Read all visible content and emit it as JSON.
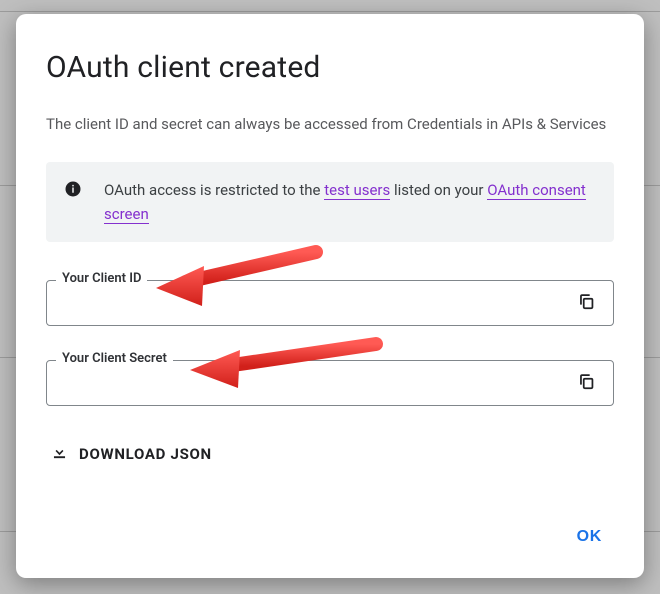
{
  "dialog": {
    "title": "OAuth client created",
    "subtitle": "The client ID and secret can always be accessed from Credentials in APIs & Services",
    "notice_pre": "OAuth access is restricted to the ",
    "notice_link1": "test users",
    "notice_mid": " listed on your ",
    "notice_link2": "OAuth consent screen"
  },
  "fields": {
    "client_id": {
      "label": "Your Client ID",
      "value": ""
    },
    "client_secret": {
      "label": "Your Client Secret",
      "value": ""
    }
  },
  "actions": {
    "download": "DOWNLOAD JSON",
    "ok": "OK"
  }
}
